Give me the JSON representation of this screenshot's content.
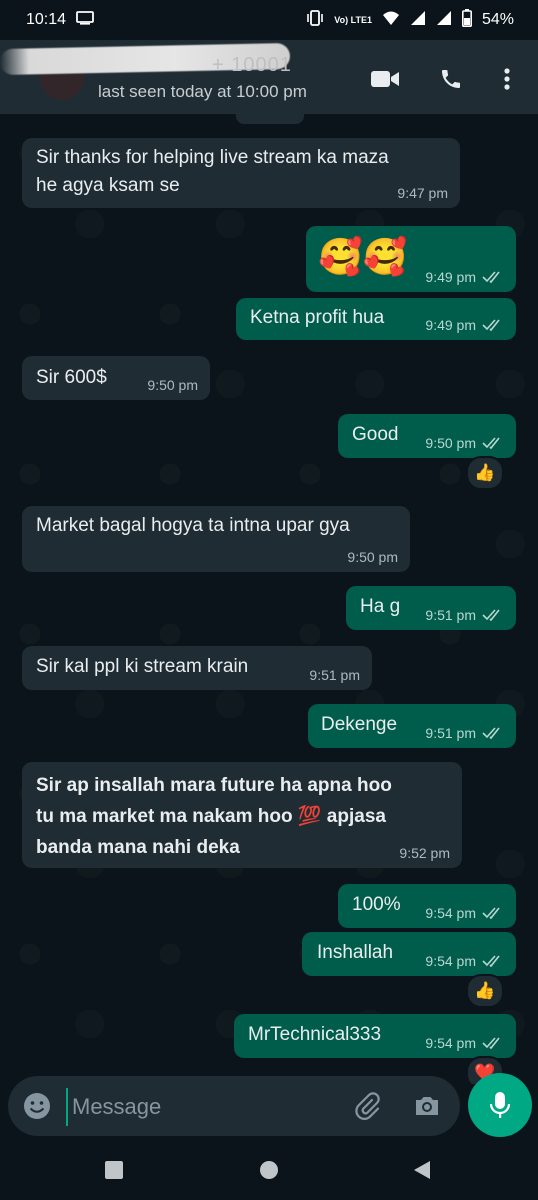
{
  "status_bar": {
    "time": "10:14",
    "carrier_label": "Vo) LTE1",
    "battery": "54%"
  },
  "header": {
    "contact_name_visible": "+ 10001",
    "last_seen": "last seen today at 10:00 pm",
    "icons": [
      "video-call-icon",
      "voice-call-icon",
      "more-options-icon"
    ]
  },
  "messages": [
    {
      "dir": "in",
      "text": "Sir thanks for helping live stream ka maza\nhe agya ksam se",
      "time": "9:47 pm"
    },
    {
      "dir": "out",
      "text": "🥰🥰",
      "time": "9:49 pm"
    },
    {
      "dir": "out",
      "text": "Ketna profit hua",
      "time": "9:49 pm"
    },
    {
      "dir": "in",
      "text": "Sir 600$",
      "time": "9:50 pm"
    },
    {
      "dir": "out",
      "text": "Good",
      "time": "9:50 pm",
      "reaction": "👍"
    },
    {
      "dir": "in",
      "text": "Market bagal hogya ta intna upar gya",
      "time": "9:50 pm"
    },
    {
      "dir": "out",
      "text": "Ha g",
      "time": "9:51 pm"
    },
    {
      "dir": "in",
      "text": "Sir kal ppl ki stream krain",
      "time": "9:51 pm"
    },
    {
      "dir": "out",
      "text": "Dekenge",
      "time": "9:51 pm"
    },
    {
      "dir": "in",
      "text": "Sir ap insallah mara future ha apna hoo\ntu ma market ma nakam hoo 💯 apjasa\nbanda mana nahi deka",
      "time": "9:52 pm"
    },
    {
      "dir": "out",
      "text": "100%",
      "time": "9:54 pm"
    },
    {
      "dir": "out",
      "text": "Inshallah",
      "time": "9:54 pm",
      "reaction": "👍"
    },
    {
      "dir": "out",
      "text": "MrTechnical333",
      "time": "9:54 pm",
      "reaction": "❤️"
    }
  ],
  "composer": {
    "placeholder": "Message",
    "icons": [
      "emoji-icon",
      "attach-icon",
      "camera-icon",
      "mic-icon"
    ]
  },
  "colors": {
    "background": "#0b141a",
    "incoming_bubble": "#1f2c34",
    "outgoing_bubble": "#005c4b",
    "accent": "#00a884",
    "read_ticks": "#b8d7d0"
  }
}
